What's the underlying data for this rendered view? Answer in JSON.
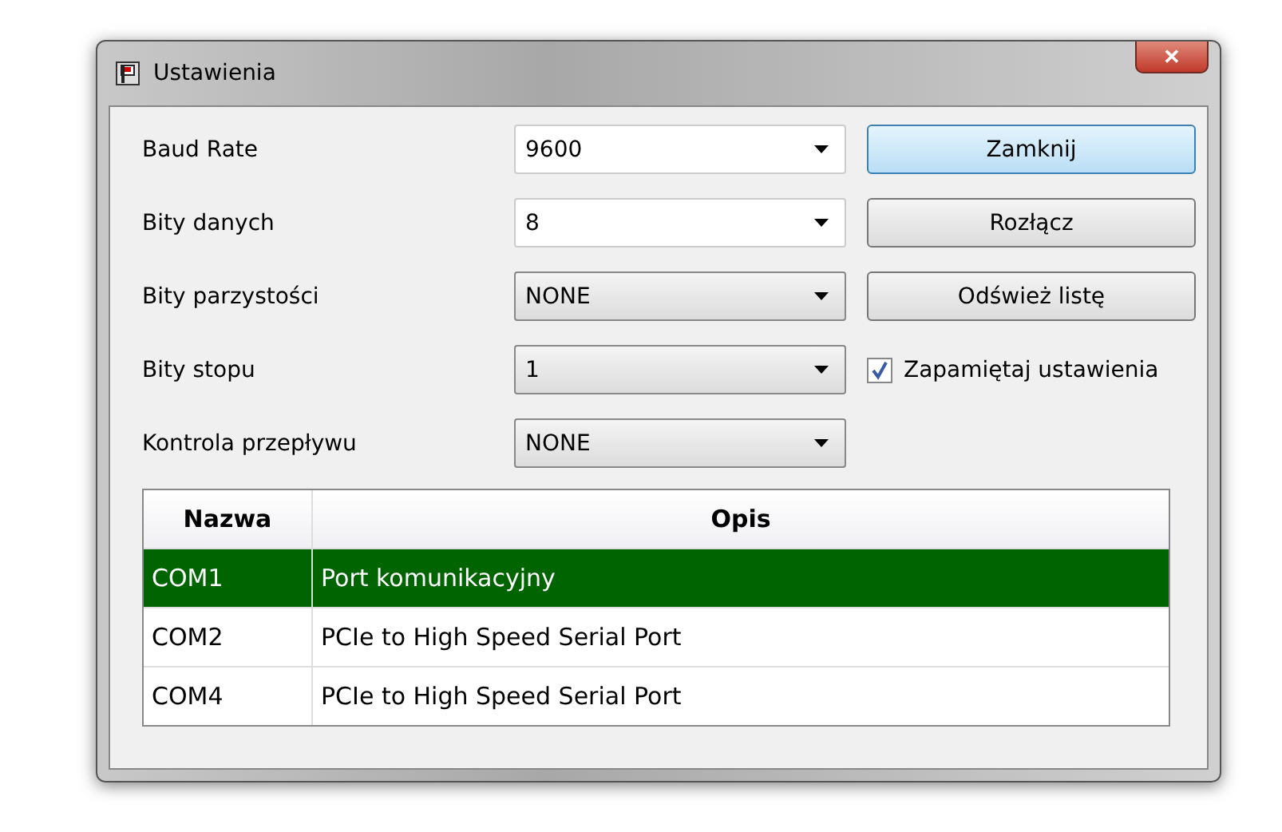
{
  "window": {
    "title": "Ustawienia",
    "close": "✕"
  },
  "settings": [
    {
      "label": "Baud Rate",
      "value": "9600",
      "kind": "editable"
    },
    {
      "label": "Bity danych",
      "value": "8",
      "kind": "editable"
    },
    {
      "label": "Bity parzystości",
      "value": "NONE",
      "kind": "dropdown"
    },
    {
      "label": "Bity stopu",
      "value": "1",
      "kind": "dropdown"
    },
    {
      "label": "Kontrola przepływu",
      "value": "NONE",
      "kind": "dropdown"
    }
  ],
  "buttons": [
    {
      "label": "Zamknij",
      "default": true
    },
    {
      "label": "Rozłącz",
      "default": false
    },
    {
      "label": "Odśwież listę",
      "default": false
    }
  ],
  "remember": {
    "label": "Zapamiętaj ustawienia",
    "checked": true
  },
  "table": {
    "columns": [
      "Nazwa",
      "Opis"
    ],
    "rows": [
      {
        "cells": [
          "COM1",
          "Port komunikacyjny"
        ],
        "selected": true
      },
      {
        "cells": [
          "COM2",
          "PCIe to High Speed Serial Port"
        ],
        "selected": false
      },
      {
        "cells": [
          "COM4",
          "PCIe to High Speed Serial Port"
        ],
        "selected": false
      }
    ]
  }
}
